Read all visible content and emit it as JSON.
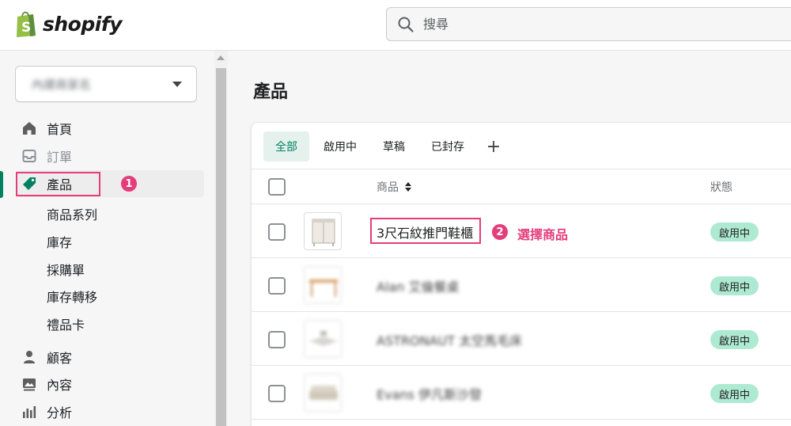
{
  "brand": {
    "name": "shopify"
  },
  "search": {
    "placeholder": "搜尋"
  },
  "sidebar": {
    "store_name": "內建商家名",
    "nav": [
      {
        "label": "首頁",
        "icon": "home-icon"
      },
      {
        "label": "訂單",
        "icon": "inbox-icon",
        "disabled": true
      },
      {
        "label": "產品",
        "icon": "tag-icon",
        "active": true
      },
      {
        "label": "顧客",
        "icon": "person-icon"
      },
      {
        "label": "內容",
        "icon": "image-icon"
      },
      {
        "label": "分析",
        "icon": "bar-chart-icon"
      }
    ],
    "sub_items": [
      "商品系列",
      "庫存",
      "採購單",
      "庫存轉移",
      "禮品卡"
    ],
    "step1_badge": "1"
  },
  "main": {
    "title": "產品",
    "tabs": [
      "全部",
      "啟用中",
      "草稿",
      "已封存"
    ],
    "tab_add": "+",
    "columns": {
      "product": "商品",
      "status": "狀態"
    },
    "rows": [
      {
        "name": "3尺石紋推門鞋櫃",
        "status": "啟用中"
      },
      {
        "name": "Alan 艾倫餐桌",
        "status": "啟用中"
      },
      {
        "name": "ASTRONAUT 太空馬毛床",
        "status": "啟用中"
      },
      {
        "name": "Evans 伊凡斯沙發",
        "status": "啟用中"
      }
    ],
    "step2_badge": "2",
    "step2_label": "選擇商品"
  },
  "colors": {
    "accent": "#008060",
    "annotation": "#e43d7a",
    "badge_green": "#aee9d1"
  }
}
